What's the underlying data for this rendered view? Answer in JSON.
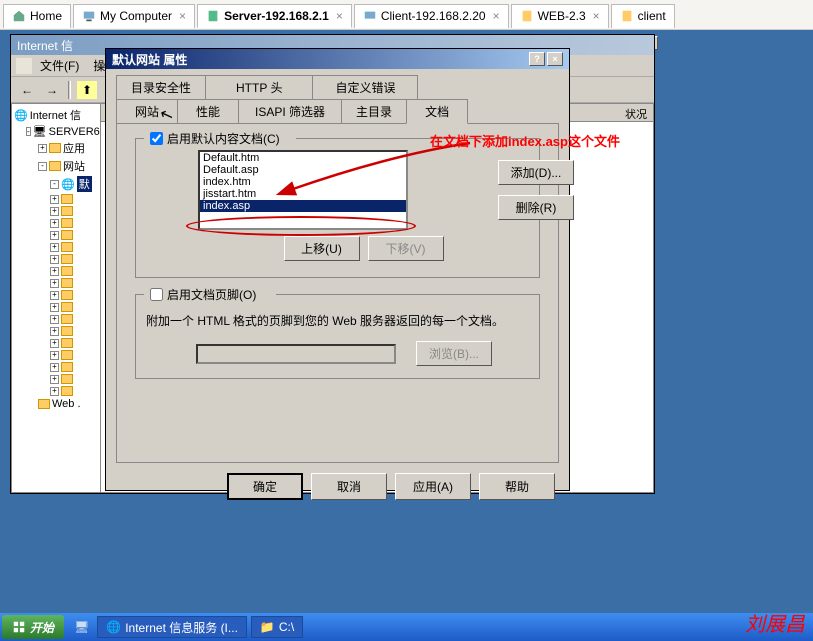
{
  "topTabs": {
    "home": "Home",
    "myComputer": "My Computer",
    "server": "Server-192.168.2.1",
    "client2": "Client-192.168.2.20",
    "web23": "WEB-2.3",
    "client": "client"
  },
  "iis": {
    "title": "Internet 信",
    "menu": {
      "file": "文件(F)",
      "op": "操"
    },
    "tree": {
      "root": "Internet 信",
      "server": "SERVER6",
      "appPool": "应用",
      "site": "网站",
      "defaultSite": "默",
      "web": "Web ."
    },
    "col": "状况"
  },
  "dialog": {
    "title": "默认网站 属性",
    "tabs": {
      "dirSecurity": "目录安全性",
      "httpHeader": "HTTP 头",
      "customError": "自定义错误",
      "website": "网站",
      "perf": "性能",
      "isapi": "ISAPI 筛选器",
      "homeDir": "主目录",
      "document": "文档"
    },
    "grp1": {
      "label": "启用默认内容文档(C)",
      "items": [
        "Default.htm",
        "Default.asp",
        "index.htm",
        "jisstart.htm",
        "index.asp"
      ],
      "add": "添加(D)...",
      "remove": "删除(R)",
      "up": "上移(U)",
      "down": "下移(V)"
    },
    "grp2": {
      "label": "启用文档页脚(O)",
      "hint": "附加一个 HTML 格式的页脚到您的 Web 服务器返回的每一个文档。",
      "browse": "浏览(B)..."
    },
    "buttons": {
      "ok": "确定",
      "cancel": "取消",
      "apply": "应用(A)",
      "help": "帮助"
    }
  },
  "annotation": "在文档下添加index.asp这个文件",
  "taskbar": {
    "start": "开始",
    "iis": "Internet 信息服务 (I...",
    "cdrive": "C:\\"
  },
  "signature": "刘展昌"
}
